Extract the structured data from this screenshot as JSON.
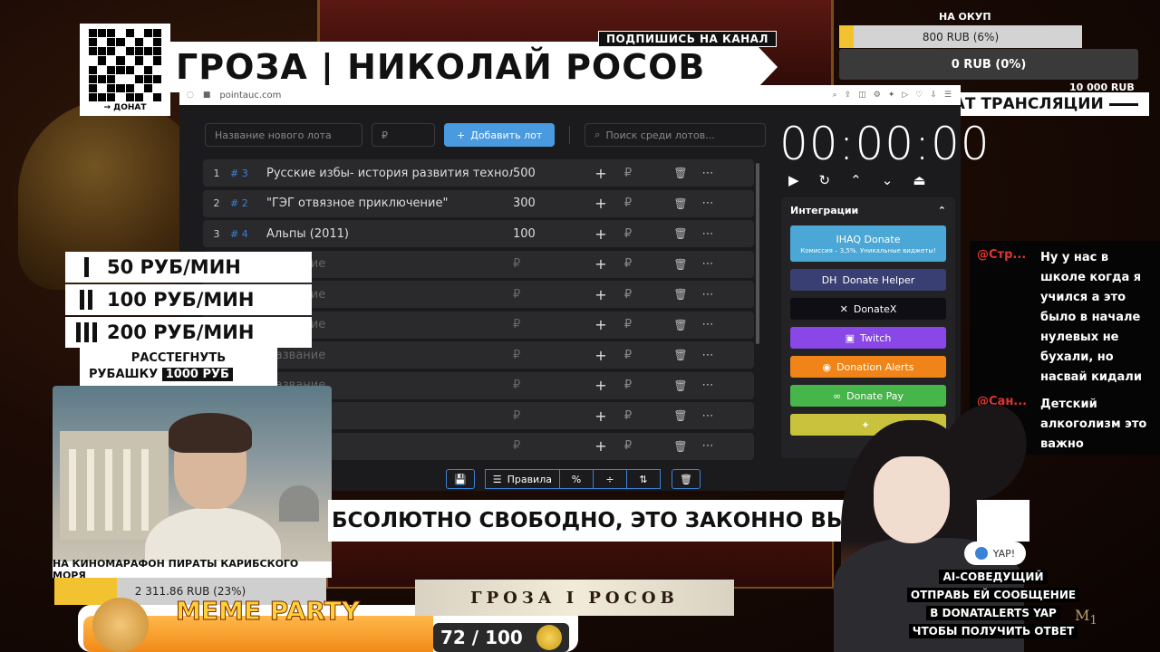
{
  "overlay": {
    "qr_caption": "→ ДОНАТ",
    "subscribe": "ПОДПИШИСЬ НА КАНАЛ",
    "title": "ГРОЗА | НИКОЛАЙ РОСОВ",
    "goal_top": {
      "label": "НА ОКУП",
      "text": "800 RUB (6%)",
      "percent": 6
    },
    "goal_zero": {
      "text": "0 RUB (0%)"
    },
    "goal_target": "10 000 RUB",
    "chat_header": "ЧАТ ТРАНСЛЯЦИИ",
    "rates": [
      {
        "text": "50 РУБ/МИН",
        "bars": 1
      },
      {
        "text": "100 РУБ/МИН",
        "bars": 2
      },
      {
        "text": "200 РУБ/МИН",
        "bars": 3
      }
    ],
    "shirt": {
      "line1": "РАССТЕГНУТЬ",
      "line2": "РУБАШКУ",
      "price": "1000 РУБ"
    },
    "cam_label": "НА КИНОМАРАФОН ПИРАТЫ КАРИБСКОГО МОРЯ",
    "cam_goal": {
      "text": "2 311.86 RUB (23%)",
      "percent": 23
    },
    "meme": {
      "title": "MEME PARTY",
      "count": "72 / 100"
    },
    "caption": "БСОЛЮТНО СВОБОДНО, ЭТО ЗАКОННО ВЫ ... ДОНАТ",
    "brand": "ГРОЗА I РОСОВ",
    "yap": "YAP!",
    "ai_lines": [
      "AI-СОВЕДУЩИЙ",
      "ОТПРАВЬ ЕЙ СООБЩЕНИЕ",
      "В DONATALERTS YAP",
      "ЧТОБЫ ПОЛУЧИТЬ ОТВЕТ"
    ]
  },
  "browser": {
    "url": "pointauc.com",
    "lot_name_placeholder": "Название нового лота",
    "amount_placeholder": "₽",
    "add_button": "Добавить лот",
    "search_placeholder": "Поиск среди лотов...",
    "lots": [
      {
        "num": "1",
        "tag": "# 3",
        "name": "Русские избы- история развития технологи",
        "amount": "500"
      },
      {
        "num": "2",
        "tag": "# 2",
        "name": "\"ГЭГ отвязное приключение\"",
        "amount": "300"
      },
      {
        "num": "3",
        "tag": "# 4",
        "name": "Альпы (2011)",
        "amount": "100"
      },
      {
        "num": "",
        "tag": "",
        "name": "Название",
        "amount": "₽"
      },
      {
        "num": "",
        "tag": "",
        "name": "Название",
        "amount": "₽"
      },
      {
        "num": "",
        "tag": "",
        "name": "Название",
        "amount": "₽"
      },
      {
        "num": "",
        "tag": "",
        "name": "Название",
        "amount": "₽"
      },
      {
        "num": "",
        "tag": "",
        "name": "Название",
        "amount": "₽"
      },
      {
        "num": "",
        "tag": "",
        "name": "",
        "amount": "₽"
      },
      {
        "num": "",
        "tag": "",
        "name": "",
        "amount": "₽"
      }
    ],
    "timer": "00:00:00",
    "integrations_title": "Интеграции",
    "integrations": [
      {
        "label": "IHAQ Donate",
        "sub": "Комиссия – 3,5%. Уникальные виджеты!",
        "color": "#4aa7d6",
        "big": true
      },
      {
        "label": "Donate Helper",
        "color": "#3a3f73",
        "icon": "DH"
      },
      {
        "label": "DonateX",
        "color": "#0e0e14",
        "icon": "✕"
      },
      {
        "label": "Twitch",
        "color": "#8847e6",
        "icon": "▣"
      },
      {
        "label": "Donation Alerts",
        "color": "#f08418",
        "icon": "◉"
      },
      {
        "label": "Donate Pay",
        "color": "#46b54a",
        "icon": "∞"
      },
      {
        "label": "",
        "color": "#c9c23c",
        "icon": "✦"
      }
    ],
    "tools": {
      "save": "💾",
      "rules": "Правила",
      "percent": "%",
      "divide": "÷",
      "sort": "⇅",
      "clear": "🗑"
    }
  },
  "chat": [
    {
      "user": "@Стр...",
      "text": "Ну у нас в школе когда я учился а это было в начале нулевых не бухали, но насвай кидали"
    },
    {
      "user": "@Сан...",
      "text": "Детский алкоголизм это важно"
    }
  ]
}
